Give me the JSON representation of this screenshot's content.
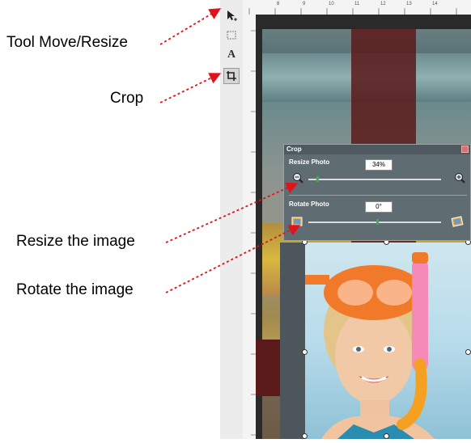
{
  "annotations": {
    "tool_move_resize": "Tool Move/Resize",
    "crop": "Crop",
    "resize_image": "Resize the image",
    "rotate_image": "Rotate the image"
  },
  "toolbar": {
    "text_tool_label": "A"
  },
  "ruler": {
    "top_numbers": [
      "8",
      "9",
      "10",
      "11",
      "12",
      "13",
      "14"
    ]
  },
  "crop_dialog": {
    "title": "Crop",
    "resize_section": "Resize Photo",
    "resize_value": "34%",
    "rotate_section": "Rotate Photo",
    "rotate_value": "0°"
  },
  "colors": {
    "arrow": "#e0121b",
    "slider_knob": "#37b34a",
    "dialog_bg": "#5f6c72"
  }
}
